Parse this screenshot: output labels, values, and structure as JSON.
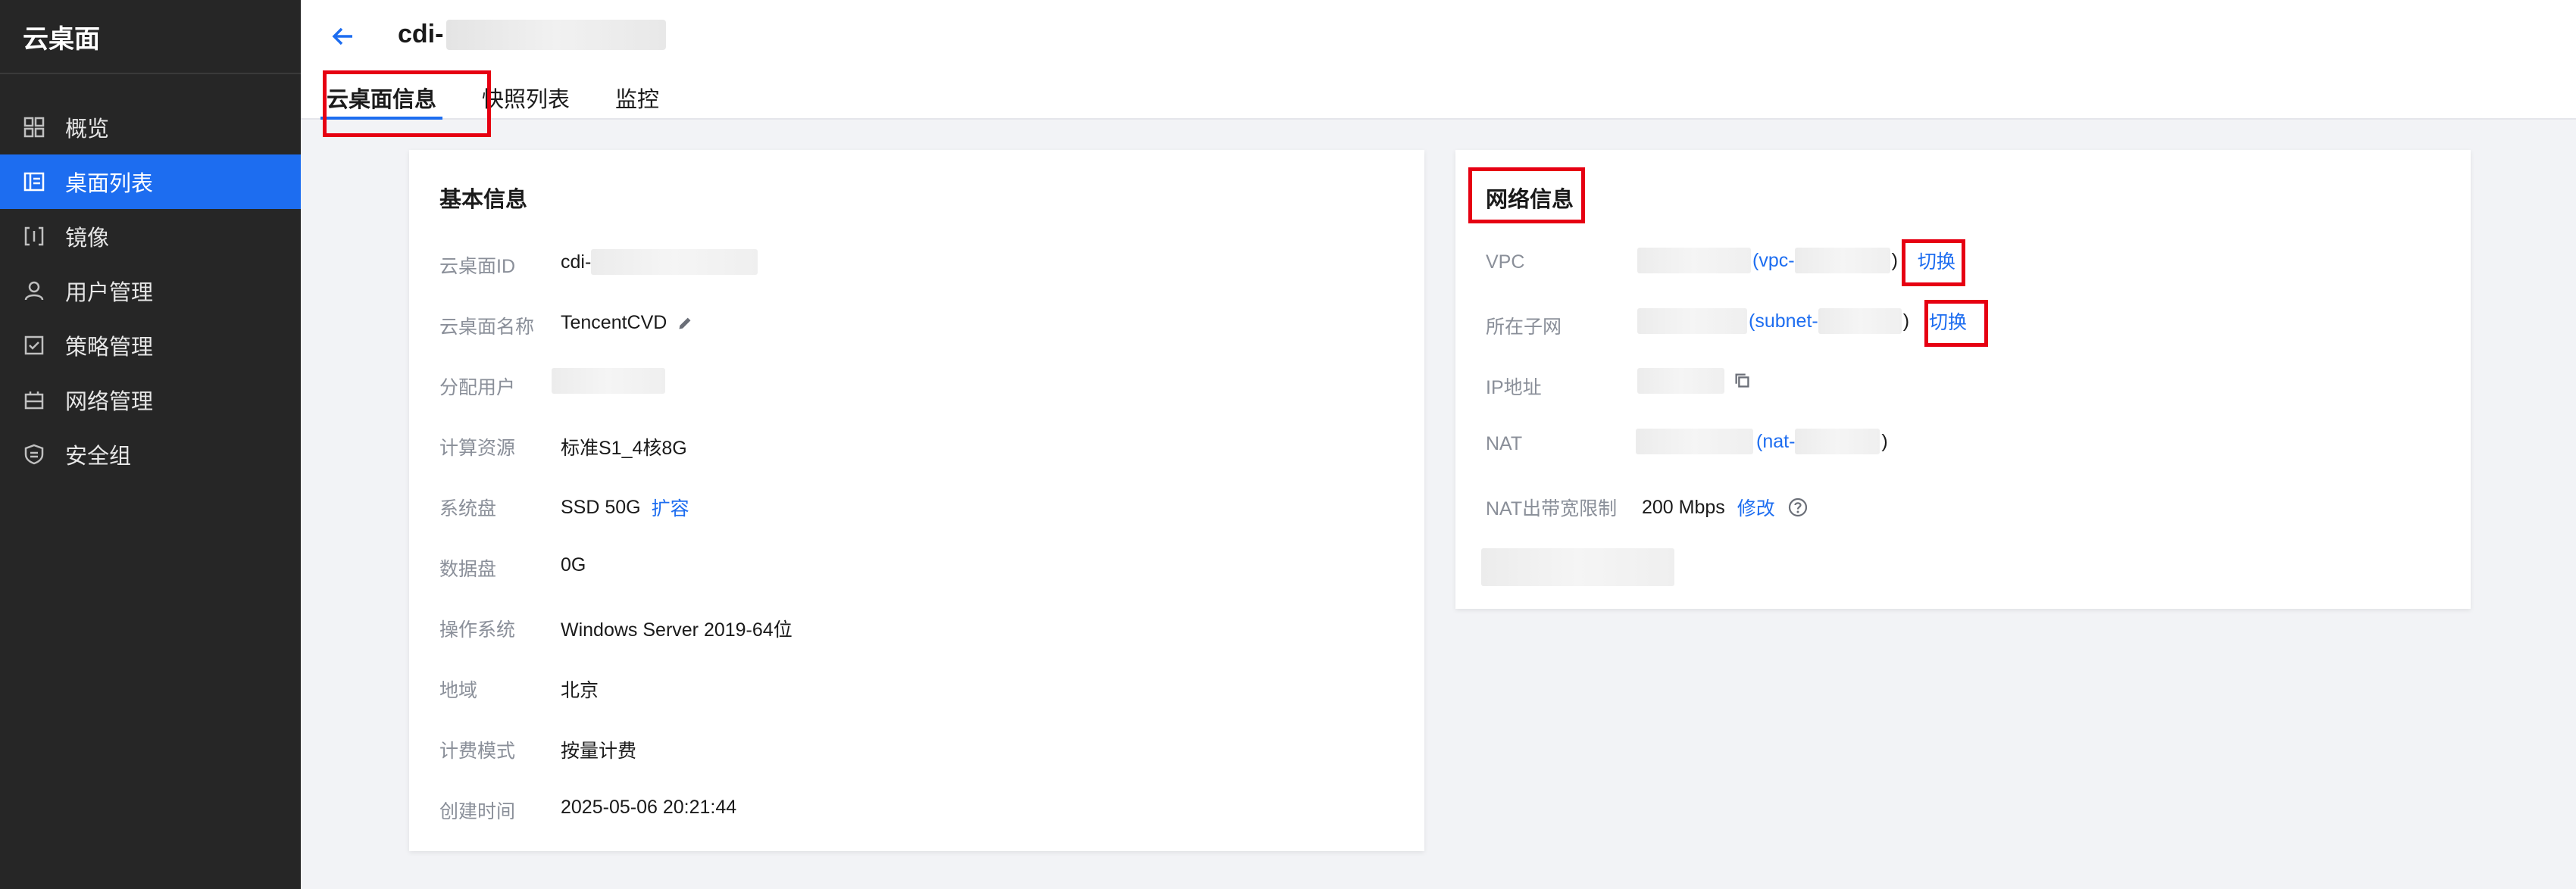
{
  "sidebar": {
    "title": "云桌面",
    "items": [
      {
        "label": "概览",
        "icon": "grid-icon"
      },
      {
        "label": "桌面列表",
        "icon": "desktop-list-icon",
        "active": true
      },
      {
        "label": "镜像",
        "icon": "image-icon"
      },
      {
        "label": "用户管理",
        "icon": "user-icon"
      },
      {
        "label": "策略管理",
        "icon": "policy-icon"
      },
      {
        "label": "网络管理",
        "icon": "network-icon"
      },
      {
        "label": "安全组",
        "icon": "shield-icon"
      }
    ]
  },
  "header": {
    "title": "cdi-",
    "tabs": [
      "云桌面信息",
      "快照列表",
      "监控"
    ]
  },
  "basic": {
    "title": "基本信息",
    "rows": [
      {
        "label": "云桌面ID",
        "value": "cdi-"
      },
      {
        "label": "云桌面名称",
        "value": "TencentCVD"
      },
      {
        "label": "分配用户",
        "value": ""
      },
      {
        "label": "计算资源",
        "value": "标准S1_4核8G"
      },
      {
        "label": "系统盘",
        "value": "SSD 50G",
        "action": "扩容"
      },
      {
        "label": "数据盘",
        "value": "0G"
      },
      {
        "label": "操作系统",
        "value": "Windows Server 2019-64位"
      },
      {
        "label": "地域",
        "value": "北京"
      },
      {
        "label": "计费模式",
        "value": "按量计费"
      },
      {
        "label": "创建时间",
        "value": "2025-05-06 20:21:44"
      }
    ]
  },
  "network": {
    "title": "网络信息",
    "vpc": {
      "label": "VPC",
      "prefix": "(vpc-",
      "suffix": ")",
      "action": "切换"
    },
    "subnet": {
      "label": "所在子网",
      "prefix": "(subnet-",
      "suffix": ")",
      "action": "切换"
    },
    "ip": {
      "label": "IP地址"
    },
    "nat": {
      "label": "NAT",
      "prefix": "(nat-",
      "suffix": ")"
    },
    "bandwidth": {
      "label": "NAT出带宽限制",
      "value": "200 Mbps",
      "action": "修改"
    }
  },
  "colors": {
    "accent": "#1d6df0",
    "sidebar": "#262626",
    "highlight": "#e60012"
  }
}
